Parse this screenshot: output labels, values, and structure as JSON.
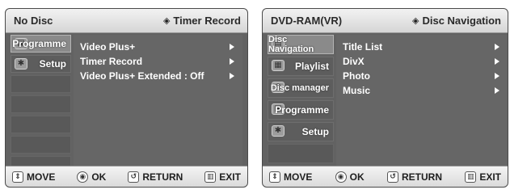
{
  "left_screen": {
    "header": {
      "title": "No Disc",
      "mode": "Timer Record",
      "mode_icon": "diamond-icon"
    },
    "sidebar": [
      {
        "label": "Programme",
        "icon": "programme-icon",
        "selected": true
      },
      {
        "label": "Setup",
        "icon": "gear-icon",
        "selected": false
      }
    ],
    "menu": [
      {
        "label": "Video Plus+",
        "has_submenu": true
      },
      {
        "label": "Timer Record",
        "has_submenu": true
      },
      {
        "label": "Video Plus+ Extended : Off",
        "has_submenu": true
      }
    ],
    "footer": {
      "move": "MOVE",
      "ok": "OK",
      "return": "RETURN",
      "exit": "EXIT"
    }
  },
  "right_screen": {
    "header": {
      "title": "DVD-RAM(VR)",
      "mode": "Disc Navigation",
      "mode_icon": "diamond-icon"
    },
    "sidebar": [
      {
        "label": "Disc Navigation",
        "icon": "disc-navigation-icon",
        "selected": true
      },
      {
        "label": "Playlist",
        "icon": "playlist-icon",
        "selected": false
      },
      {
        "label": "Disc manager",
        "icon": "disc-manager-icon",
        "selected": false
      },
      {
        "label": "Programme",
        "icon": "programme-icon",
        "selected": false
      },
      {
        "label": "Setup",
        "icon": "gear-icon",
        "selected": false
      }
    ],
    "menu": [
      {
        "label": "Title List",
        "has_submenu": true
      },
      {
        "label": "DivX",
        "has_submenu": true
      },
      {
        "label": "Photo",
        "has_submenu": true
      },
      {
        "label": "Music",
        "has_submenu": true
      }
    ],
    "footer": {
      "move": "MOVE",
      "ok": "OK",
      "return": "RETURN",
      "exit": "EXIT"
    }
  },
  "colors": {
    "panel": "#626262",
    "selected_item": "#8a8a8a",
    "bar": "#e6e6e6",
    "text_light": "#ffffff",
    "text_dark": "#1e1e1e"
  }
}
